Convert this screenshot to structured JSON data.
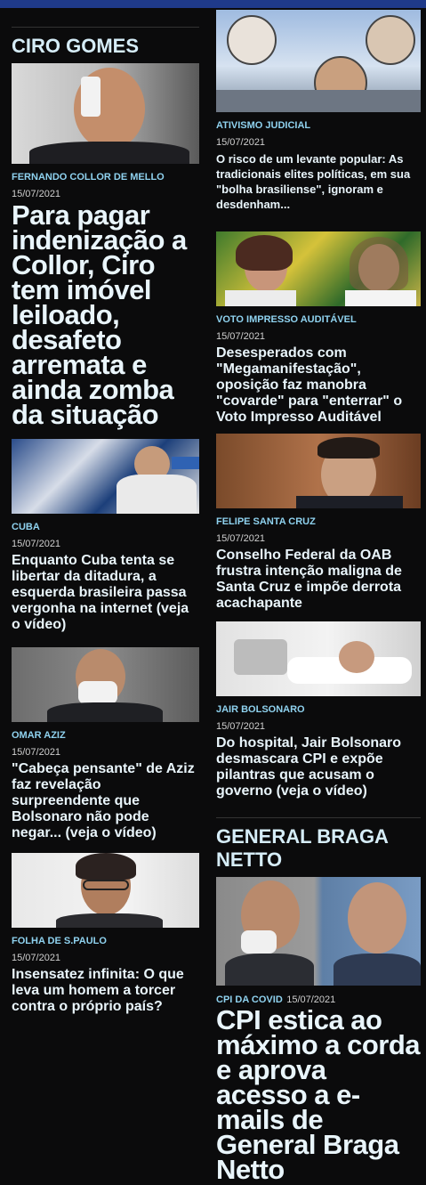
{
  "left": {
    "section_title": "CIRO GOMES",
    "articles": [
      {
        "category": "FERNANDO COLLOR DE MELLO",
        "date": "15/07/2021",
        "headline": "Para pagar indenização a Collor, Ciro tem imóvel leiloado, desafeto arremata e ainda zomba da situação"
      },
      {
        "category": "CUBA",
        "date": "15/07/2021",
        "headline": "Enquanto Cuba tenta se libertar da ditadura, a esquerda brasileira passa vergonha na internet (veja o vídeo)"
      },
      {
        "category": "OMAR AZIZ",
        "date": "15/07/2021",
        "headline": "\"Cabeça pensante\" de Aziz faz revelação surpreendente que Bolsonaro não pode negar... (veja o vídeo)"
      },
      {
        "category": "FOLHA DE S.PAULO",
        "date": "15/07/2021",
        "headline": "Insensatez infinita: O que leva um homem a torcer contra o próprio país?"
      }
    ]
  },
  "right": {
    "articles": [
      {
        "category": "ATIVISMO JUDICIAL",
        "date": "15/07/2021",
        "headline": "O risco de um levante popular: As tradicionais elites políticas, em sua \"bolha brasiliense\", ignoram e desdenham..."
      },
      {
        "category": "VOTO IMPRESSO AUDITÁVEL",
        "date": "15/07/2021",
        "headline": "Desesperados com \"Megamanifestação\", oposição faz manobra \"covarde\" para \"enterrar\" o Voto Impresso Auditável"
      },
      {
        "category": "FELIPE SANTA CRUZ",
        "date": "15/07/2021",
        "headline": "Conselho Federal da OAB frustra intenção maligna de Santa Cruz e impõe derrota acachapante"
      },
      {
        "category": "JAIR BOLSONARO",
        "date": "15/07/2021",
        "headline": "Do hospital, Jair Bolsonaro desmascara CPI e expõe pilantras que acusam o governo (veja o vídeo)"
      }
    ],
    "section_title": "GENERAL BRAGA NETTO",
    "featured": {
      "category": "CPI DA COVID",
      "date": "15/07/2021",
      "headline": "CPI estica ao máximo a corda e aprova acesso a e-mails de General Braga Netto"
    }
  },
  "colors": {
    "background": "#0b0b0c",
    "accent_blue": "#1f3a8a",
    "category": "#8fd2ef",
    "headline": "#e9f5fb"
  }
}
